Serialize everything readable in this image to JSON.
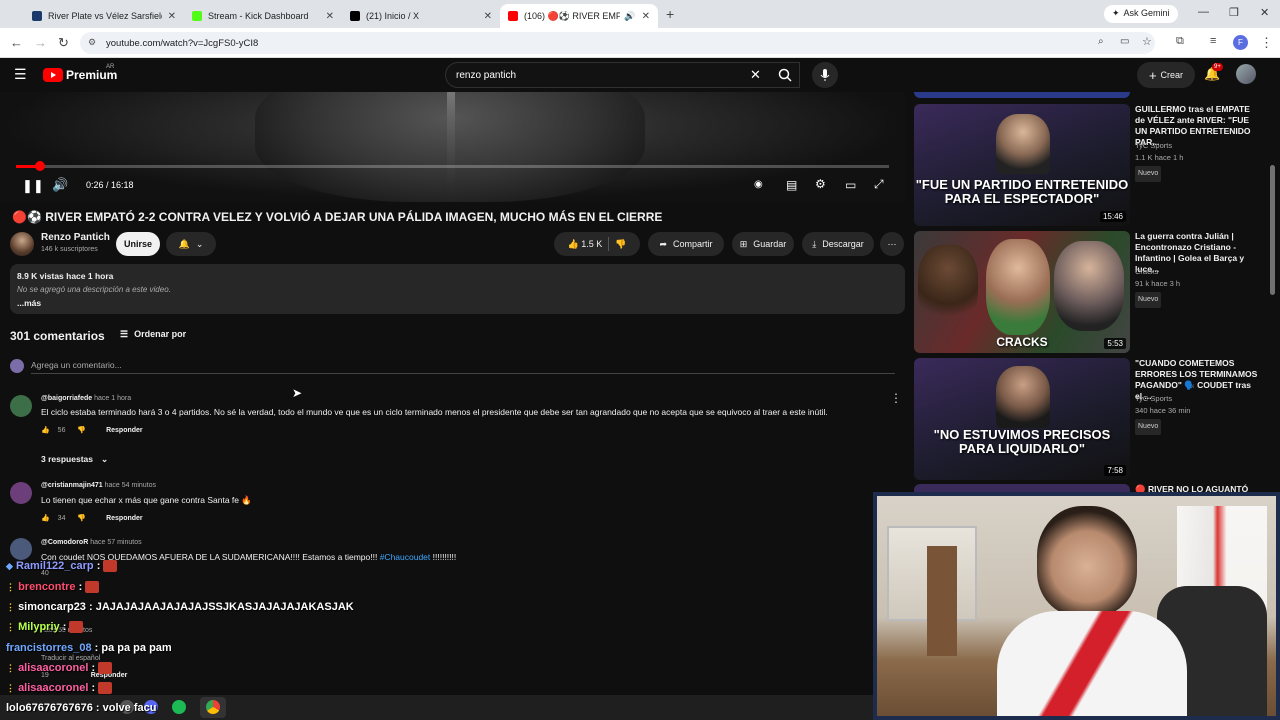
{
  "browser": {
    "tabs": [
      {
        "label": "River Plate vs Vélez Sarsfield - |",
        "favicon": "#1b3a6b"
      },
      {
        "label": "Stream - Kick Dashboard",
        "favicon": "#53fc18"
      },
      {
        "label": "(21) Inicio / X",
        "favicon": "#000000"
      },
      {
        "label": "(106) 🔴⚽ RIVER EMPATÓ",
        "favicon": "#ff0000"
      }
    ],
    "url": "youtube.com/watch?v=JcgFS0-yCI8",
    "gemini_label": "Ask Gemini",
    "profile_initial": "F"
  },
  "youtube": {
    "logo": "Premium",
    "country": "AR",
    "search_value": "renzo pantich",
    "create_label": "Crear",
    "notif_count": "9+"
  },
  "player": {
    "time": "0:26 / 16:18",
    "progress_fraction": 0.027
  },
  "video": {
    "title": "🔴⚽ RIVER EMPATÓ 2-2 CONTRA VELEZ Y VOLVIÓ A DEJAR UNA PÁLIDA IMAGEN, MUCHO MÁS EN EL CIERRE",
    "channel": "Renzo Pantich",
    "subscribers": "146 k suscriptores",
    "join_label": "Unirse",
    "likes": "1.5 K",
    "share_label": "Compartir",
    "save_label": "Guardar",
    "download_label": "Descargar",
    "views_line": "8.9 K vistas  hace 1 hora",
    "desc_text": "No se agregó una descripción a este video.",
    "more_label": "...más"
  },
  "comments": {
    "count_label": "301 comentarios",
    "sort_label": "Ordenar por",
    "add_placeholder": "Agrega un comentario...",
    "reply_label": "Responder",
    "items": [
      {
        "user": "@baigorriafede",
        "time": "hace 1 hora",
        "text": "El ciclo estaba terminado hará 3 o 4 partidos. No sé la verdad, todo el mundo ve que es un ciclo terminado menos el presidente que debe ser tan agrandado que no acepta que se equivoco al traer a este inútil.",
        "likes": "56",
        "replies": "3 respuestas"
      },
      {
        "user": "@cristianmajin471",
        "time": "hace 54 minutos",
        "text": "Lo tienen que echar x más que gane contra Santa fe 🔥",
        "likes": "34"
      },
      {
        "user": "@ComodoroR",
        "time": "hace 57 minutos",
        "text": "Con coudet NOS QUEDAMOS AFUERA DE LA SUDAMERICANA!!!! Estamos a tiempo!!! ",
        "hashtag": "#Chaucoudet",
        "tail": " !!!!!!!!!!",
        "likes": "40"
      },
      {
        "user": "",
        "time": "hace 55 minutos",
        "text": "Traducir al español",
        "likes": "19"
      }
    ]
  },
  "recommendations": [
    {
      "title": "GUILLERMO tras el EMPATE de VÉLEZ ante RIVER: \"FUE UN PARTIDO ENTRETENIDO PAR...",
      "channel": "TyC Sports",
      "stats": "1.1 K  hace 1 h",
      "badge": "Nuevo",
      "duration": "15:46",
      "caption": "\"FUE UN PARTIDO ENTRETENIDO PARA EL ESPECTADOR\""
    },
    {
      "title": "La guerra contra Julián | Encontronazo Cristiano - Infantino | Golea el Barça y luce...",
      "channel": "Cracks",
      "stats": "91 k  hace 3 h",
      "badge": "Nuevo",
      "duration": "5:53",
      "caption": "CRACKS"
    },
    {
      "title": "\"CUANDO COMETEMOS ERRORES LOS TERMINAMOS PAGANDO\" 🗣️ COUDET tras el ...",
      "channel": "TyC Sports",
      "stats": "340  hace 36 min",
      "badge": "Nuevo",
      "duration": "7:58",
      "caption": "\"NO ESTUVIMOS PRECISOS PARA LIQUIDARLO\""
    },
    {
      "title": "🔴 RIVER NO LO AGUANTÓ Y..."
    }
  ],
  "chat": [
    {
      "user": "Ramil122_carp",
      "color": "#8e9cff",
      "msg": ""
    },
    {
      "user": "brencontre",
      "color": "#ff4d6d",
      "msg": ""
    },
    {
      "user": "simoncarp23",
      "color": "#ffffff",
      "msg": "JAJAJAJAAJAJAJAJSSJKASJAJAJAJAKASJAK"
    },
    {
      "user": "Milypriy",
      "color": "#b6ff4d",
      "msg": ""
    },
    {
      "user": "francistorres_08",
      "color": "#6ea8ff",
      "msg": "pa pa pa pam"
    },
    {
      "user": "alisaacoronel",
      "color": "#ff5fa2",
      "msg": ""
    },
    {
      "user": "alisaacoronel",
      "color": "#ff5fa2",
      "msg": ""
    },
    {
      "user": "lolo67676767676",
      "color": "#ffffff",
      "msg": "volve facu"
    }
  ]
}
